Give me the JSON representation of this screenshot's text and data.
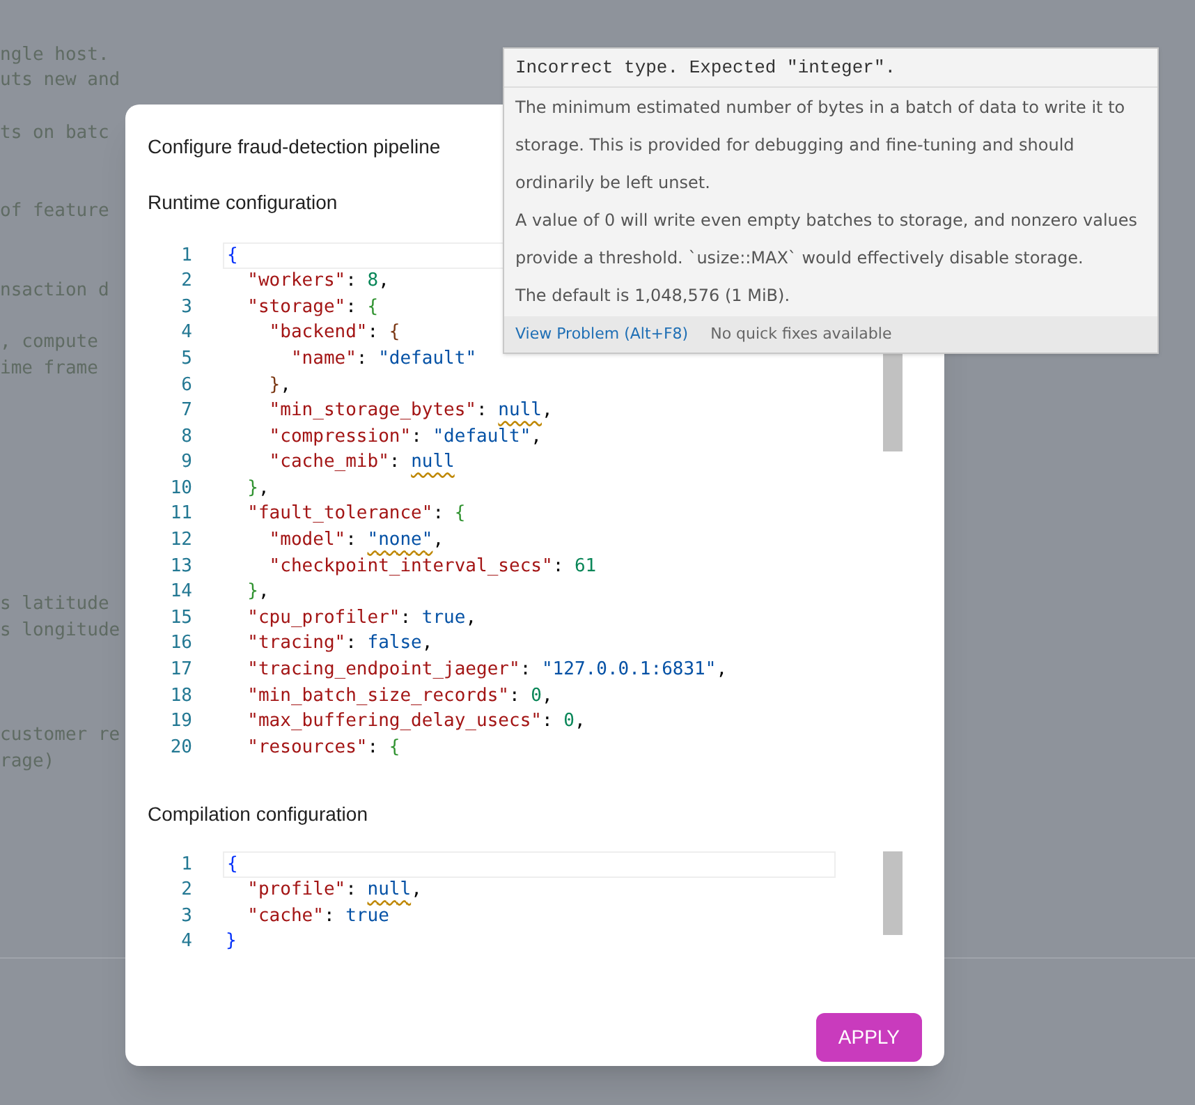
{
  "background_code": [
    "ngle host.",
    "uts new and",
    "ts on batc",
    "of feature",
    "nsaction d",
    ", compute",
    "ime frame",
    "s latitude",
    "s longitude",
    "customer re",
    "rage)"
  ],
  "dialog": {
    "title": "Configure fraud-detection pipeline",
    "runtime_section": {
      "heading": "Runtime configuration",
      "lines": [
        {
          "number": "1",
          "tokens": [
            {
              "kind": "bracket1",
              "text": "{"
            }
          ]
        },
        {
          "number": "2",
          "tokens": [
            {
              "kind": "key",
              "text": "  \"workers\""
            },
            {
              "kind": "punct",
              "text": ": "
            },
            {
              "kind": "number",
              "text": "8"
            },
            {
              "kind": "punct",
              "text": ","
            }
          ]
        },
        {
          "number": "3",
          "tokens": [
            {
              "kind": "key",
              "text": "  \"storage\""
            },
            {
              "kind": "punct",
              "text": ": "
            },
            {
              "kind": "bracket2",
              "text": "{"
            }
          ]
        },
        {
          "number": "4",
          "tokens": [
            {
              "kind": "key",
              "text": "    \"backend\""
            },
            {
              "kind": "punct",
              "text": ": "
            },
            {
              "kind": "bracket3",
              "text": "{"
            }
          ]
        },
        {
          "number": "5",
          "tokens": [
            {
              "kind": "key",
              "text": "      \"name\""
            },
            {
              "kind": "punct",
              "text": ": "
            },
            {
              "kind": "string",
              "text": "\"default\""
            }
          ]
        },
        {
          "number": "6",
          "tokens": [
            {
              "kind": "bracket3",
              "text": "    }"
            },
            {
              "kind": "punct",
              "text": ","
            }
          ]
        },
        {
          "number": "7",
          "tokens": [
            {
              "kind": "key",
              "text": "    \"min_storage_bytes\""
            },
            {
              "kind": "punct",
              "text": ": "
            },
            {
              "kind": "null",
              "text": "null",
              "warning": true
            },
            {
              "kind": "punct",
              "text": ","
            }
          ]
        },
        {
          "number": "8",
          "tokens": [
            {
              "kind": "key",
              "text": "    \"compression\""
            },
            {
              "kind": "punct",
              "text": ": "
            },
            {
              "kind": "string",
              "text": "\"default\""
            },
            {
              "kind": "punct",
              "text": ","
            }
          ]
        },
        {
          "number": "9",
          "tokens": [
            {
              "kind": "key",
              "text": "    \"cache_mib\""
            },
            {
              "kind": "punct",
              "text": ": "
            },
            {
              "kind": "null",
              "text": "null",
              "warning": true
            }
          ]
        },
        {
          "number": "10",
          "tokens": [
            {
              "kind": "bracket2",
              "text": "  }"
            },
            {
              "kind": "punct",
              "text": ","
            }
          ]
        },
        {
          "number": "11",
          "tokens": [
            {
              "kind": "key",
              "text": "  \"fault_tolerance\""
            },
            {
              "kind": "punct",
              "text": ": "
            },
            {
              "kind": "bracket2",
              "text": "{"
            }
          ]
        },
        {
          "number": "12",
          "tokens": [
            {
              "kind": "key",
              "text": "    \"model\""
            },
            {
              "kind": "punct",
              "text": ": "
            },
            {
              "kind": "string",
              "text": "\"none\"",
              "warning": true
            },
            {
              "kind": "punct",
              "text": ","
            }
          ]
        },
        {
          "number": "13",
          "tokens": [
            {
              "kind": "key",
              "text": "    \"checkpoint_interval_secs\""
            },
            {
              "kind": "punct",
              "text": ": "
            },
            {
              "kind": "number",
              "text": "61"
            }
          ]
        },
        {
          "number": "14",
          "tokens": [
            {
              "kind": "bracket2",
              "text": "  }"
            },
            {
              "kind": "punct",
              "text": ","
            }
          ]
        },
        {
          "number": "15",
          "tokens": [
            {
              "kind": "key",
              "text": "  \"cpu_profiler\""
            },
            {
              "kind": "punct",
              "text": ": "
            },
            {
              "kind": "bool",
              "text": "true"
            },
            {
              "kind": "punct",
              "text": ","
            }
          ]
        },
        {
          "number": "16",
          "tokens": [
            {
              "kind": "key",
              "text": "  \"tracing\""
            },
            {
              "kind": "punct",
              "text": ": "
            },
            {
              "kind": "bool",
              "text": "false"
            },
            {
              "kind": "punct",
              "text": ","
            }
          ]
        },
        {
          "number": "17",
          "tokens": [
            {
              "kind": "key",
              "text": "  \"tracing_endpoint_jaeger\""
            },
            {
              "kind": "punct",
              "text": ": "
            },
            {
              "kind": "string",
              "text": "\"127.0.0.1:6831\""
            },
            {
              "kind": "punct",
              "text": ","
            }
          ]
        },
        {
          "number": "18",
          "tokens": [
            {
              "kind": "key",
              "text": "  \"min_batch_size_records\""
            },
            {
              "kind": "punct",
              "text": ": "
            },
            {
              "kind": "number",
              "text": "0"
            },
            {
              "kind": "punct",
              "text": ","
            }
          ]
        },
        {
          "number": "19",
          "tokens": [
            {
              "kind": "key",
              "text": "  \"max_buffering_delay_usecs\""
            },
            {
              "kind": "punct",
              "text": ": "
            },
            {
              "kind": "number",
              "text": "0"
            },
            {
              "kind": "punct",
              "text": ","
            }
          ]
        },
        {
          "number": "20",
          "tokens": [
            {
              "kind": "key",
              "text": "  \"resources\""
            },
            {
              "kind": "punct",
              "text": ": "
            },
            {
              "kind": "bracket2",
              "text": "{"
            }
          ]
        }
      ]
    },
    "compilation_section": {
      "heading": "Compilation configuration",
      "lines": [
        {
          "number": "1",
          "tokens": [
            {
              "kind": "bracket1",
              "text": "{"
            }
          ]
        },
        {
          "number": "2",
          "tokens": [
            {
              "kind": "key",
              "text": "  \"profile\""
            },
            {
              "kind": "punct",
              "text": ": "
            },
            {
              "kind": "null",
              "text": "null",
              "warning": true
            },
            {
              "kind": "punct",
              "text": ","
            }
          ]
        },
        {
          "number": "3",
          "tokens": [
            {
              "kind": "key",
              "text": "  \"cache\""
            },
            {
              "kind": "punct",
              "text": ": "
            },
            {
              "kind": "bool",
              "text": "true"
            }
          ]
        },
        {
          "number": "4",
          "tokens": [
            {
              "kind": "bracket1",
              "text": "}"
            }
          ]
        }
      ]
    },
    "apply_button": "APPLY"
  },
  "hover_tooltip": {
    "error": "Incorrect type. Expected \"integer\".",
    "paragraphs": [
      "The minimum estimated number of bytes in a batch of data to write it to storage. This is provided for debugging and fine-tuning and should ordinarily be left unset.",
      "A value of 0 will write even empty batches to storage, and nonzero values provide a threshold. `usize::MAX` would effectively disable storage.",
      "The default is 1,048,576 (1 MiB)."
    ],
    "link": "View Problem (Alt+F8)",
    "status": "No quick fixes available"
  }
}
